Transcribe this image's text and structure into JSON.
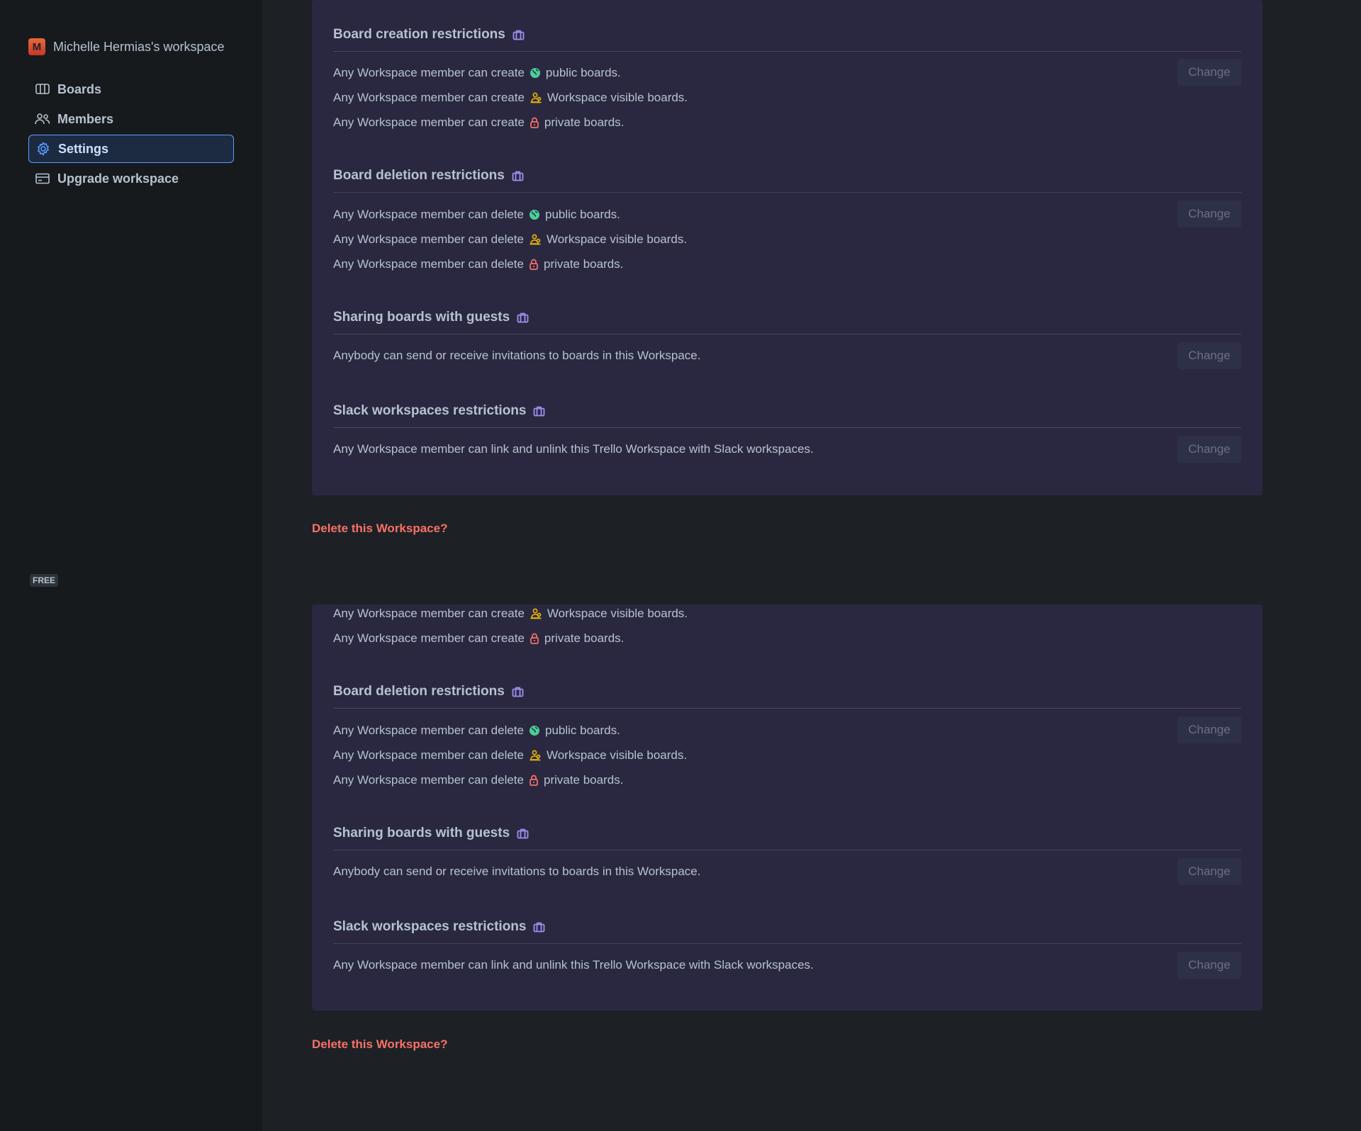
{
  "workspace": {
    "avatar_letter": "M",
    "name": "Michelle Hermias's workspace"
  },
  "nav": [
    {
      "label": "Boards",
      "icon": "boards-icon"
    },
    {
      "label": "Members",
      "icon": "members-icon"
    },
    {
      "label": "Settings",
      "icon": "gear-icon",
      "active": true
    },
    {
      "label": "Upgrade workspace",
      "icon": "credit-card-icon"
    }
  ],
  "plan_badge": "FREE",
  "colors": {
    "public": "#4bce97",
    "workspace": "#e2b203",
    "private": "#f87168",
    "upgrade": "#9f8fef",
    "delete": "#f87168"
  },
  "top": {
    "creation": {
      "title": "Board creation restrictions",
      "rows": [
        {
          "prefix": "Any Workspace member can create",
          "icon": "globe-icon",
          "suffix": "public boards."
        },
        {
          "prefix": "Any Workspace member can create",
          "icon": "workspace-people-icon",
          "suffix": "Workspace visible boards."
        },
        {
          "prefix": "Any Workspace member can create",
          "icon": "lock-icon",
          "suffix": "private boards."
        }
      ],
      "change": "Change"
    },
    "deletion": {
      "title": "Board deletion restrictions",
      "rows": [
        {
          "prefix": "Any Workspace member can delete",
          "icon": "globe-icon",
          "suffix": "public boards."
        },
        {
          "prefix": "Any Workspace member can delete",
          "icon": "workspace-people-icon",
          "suffix": "Workspace visible boards."
        },
        {
          "prefix": "Any Workspace member can delete",
          "icon": "lock-icon",
          "suffix": "private boards."
        }
      ],
      "change": "Change"
    },
    "sharing": {
      "title": "Sharing boards with guests",
      "text": "Anybody can send or receive invitations to boards in this Workspace.",
      "change": "Change"
    },
    "slack": {
      "title": "Slack workspaces restrictions",
      "text": "Any Workspace member can link and unlink this Trello Workspace with Slack workspaces.",
      "change": "Change"
    },
    "delete_link": "Delete this Workspace?"
  },
  "bottom": {
    "creation_rows": [
      {
        "prefix": "Any Workspace member can create",
        "icon": "workspace-people-icon",
        "suffix": "Workspace visible boards."
      },
      {
        "prefix": "Any Workspace member can create",
        "icon": "lock-icon",
        "suffix": "private boards."
      }
    ],
    "deletion": {
      "title": "Board deletion restrictions",
      "rows": [
        {
          "prefix": "Any Workspace member can delete",
          "icon": "globe-icon",
          "suffix": "public boards."
        },
        {
          "prefix": "Any Workspace member can delete",
          "icon": "workspace-people-icon",
          "suffix": "Workspace visible boards."
        },
        {
          "prefix": "Any Workspace member can delete",
          "icon": "lock-icon",
          "suffix": "private boards."
        }
      ],
      "change": "Change"
    },
    "sharing": {
      "title": "Sharing boards with guests",
      "text": "Anybody can send or receive invitations to boards in this Workspace.",
      "change": "Change"
    },
    "slack": {
      "title": "Slack workspaces restrictions",
      "text": "Any Workspace member can link and unlink this Trello Workspace with Slack workspaces.",
      "change": "Change"
    },
    "delete_link": "Delete this Workspace?"
  }
}
